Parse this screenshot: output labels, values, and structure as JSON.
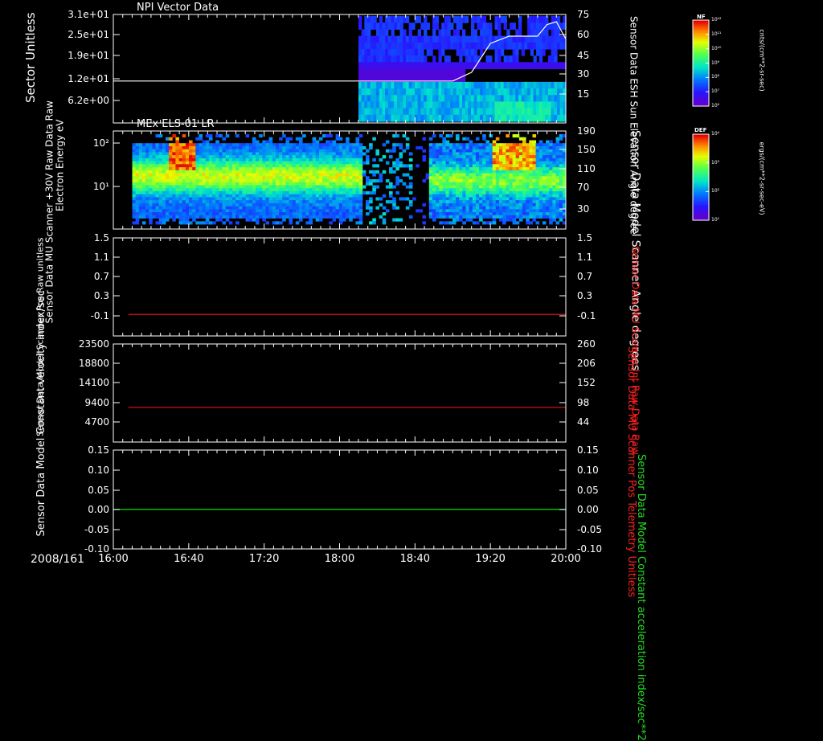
{
  "figure": {
    "date_label": "2008/161",
    "time_ticks": [
      "16:00",
      "16:40",
      "17:20",
      "18:00",
      "18:40",
      "19:20",
      "20:00"
    ]
  },
  "colors": {
    "axis": "#ffffff",
    "red_series": "#d01010",
    "green_series": "#00cc00",
    "red_label": "#ff2020",
    "green_label": "#22dd22"
  },
  "chart_data": [
    {
      "type": "heatmap",
      "title": "NPI Vector Data",
      "ylabel": "Sector Unitless",
      "y_ticks": [
        "3.1e+01",
        "2.5e+01",
        "1.9e+01",
        "1.2e+01",
        "6.2e+00"
      ],
      "y2label": "Sensor Data ESH Sun Elevation Angle degree",
      "y2_ticks": [
        "75",
        "60",
        "45",
        "30",
        "15"
      ],
      "y2lim": [
        0,
        75
      ],
      "overlay_series": {
        "x": [
          "16:00",
          "18:00",
          "19:00",
          "19:10",
          "19:20",
          "19:30",
          "19:45",
          "19:50",
          "19:55",
          "20:00"
        ],
        "y": [
          29,
          29,
          29,
          35,
          55,
          60,
          60,
          68,
          70,
          58
        ]
      },
      "colorbar": {
        "title": "NF",
        "unit": "cnts/(cm**2-sr-sec)",
        "ticks": [
          "10¹²",
          "10¹¹",
          "10¹⁰",
          "10⁹",
          "10⁸",
          "10⁷",
          "10⁶"
        ]
      },
      "data_time_range": [
        "18:10",
        "20:00"
      ]
    },
    {
      "type": "heatmap",
      "title": "MEx ELS-01 LR",
      "ylabel": "Electron Energy eV",
      "y_ticks": [
        "10²",
        "10¹"
      ],
      "y2label": "Sensor Data Model Scanner Angle degrees",
      "y2_ticks": [
        "190",
        "150",
        "110",
        "70",
        "30"
      ],
      "y2lim": [
        10,
        190
      ],
      "overlay_series": {
        "x": [
          "16:00",
          "20:00"
        ],
        "y": [
          10,
          10
        ]
      },
      "colorbar": {
        "title": "DEF",
        "unit": "ergs/(cm**2-sr-sec-eV)",
        "ticks": [
          "10⁴",
          "10³",
          "10²",
          "10¹"
        ]
      },
      "data_time_range": [
        "16:10",
        "20:00"
      ]
    },
    {
      "type": "line",
      "ylabel": "Sensor Data MU Scanner +30V Raw Data Raw",
      "y_ticks": [
        "1.5",
        "1.1",
        "0.7",
        "0.3",
        "-0.1"
      ],
      "ylim": [
        -0.5,
        1.5
      ],
      "y2label": "Sensor Data MU Scanner Int Raw Data Raw",
      "y2_ticks": [
        "1.5",
        "1.1",
        "0.7",
        "0.3",
        "-0.1"
      ],
      "y2lim": [
        -0.5,
        1.5
      ],
      "series": [
        {
          "x": [
            "16:08",
            "20:00"
          ],
          "y": [
            -0.06,
            -0.06
          ]
        }
      ]
    },
    {
      "type": "line",
      "ylabel": "Sensor Data Model Scanner Pos Raw unitless",
      "y_ticks": [
        "23500",
        "18800",
        "14100",
        "9400",
        "4700"
      ],
      "ylim": [
        0,
        23500
      ],
      "y2label": "Sensor Data MU Scanner Pos Telemetry Unitless",
      "y2_ticks": [
        "260",
        "206",
        "152",
        "98",
        "44"
      ],
      "y2lim": [
        -10,
        260
      ],
      "series": [
        {
          "x": [
            "16:08",
            "20:00"
          ],
          "y": [
            8300,
            8300
          ]
        }
      ]
    },
    {
      "type": "line",
      "ylabel": "Sensor Data Model Constant velocity index/sec",
      "y_ticks": [
        "0.15",
        "0.10",
        "0.05",
        "0.00",
        "-0.05",
        "-0.10"
      ],
      "ylim": [
        -0.1,
        0.15
      ],
      "y2label": "Sensor Data Model Constant acceleration index/sec**2",
      "y2_ticks": [
        "0.15",
        "0.10",
        "0.05",
        "0.00",
        "-0.05",
        "-0.10"
      ],
      "y2lim": [
        -0.1,
        0.15
      ],
      "series": [
        {
          "x": [
            "16:00",
            "20:00"
          ],
          "y": [
            0.0,
            0.0
          ]
        }
      ]
    }
  ]
}
